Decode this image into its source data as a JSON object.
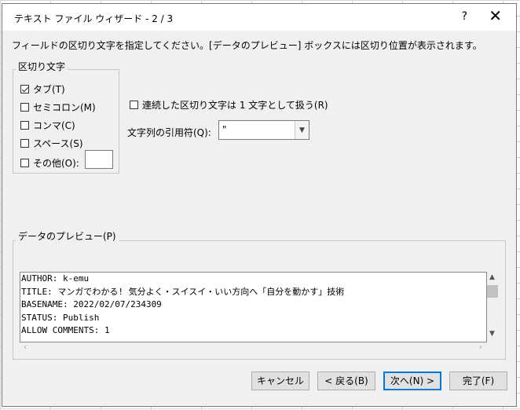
{
  "dialog": {
    "title": "テキスト ファイル ウィザード - 2 / 3",
    "help_label": "?",
    "close_label": "✕",
    "instruction": "フィールドの区切り文字を指定してください。[データのプレビュー] ボックスには区切り位置が表示されます。"
  },
  "delimiters": {
    "group_label": "区切り文字",
    "items": [
      {
        "label": "タブ(T)",
        "checked": true
      },
      {
        "label": "セミコロン(M)",
        "checked": false
      },
      {
        "label": "コンマ(C)",
        "checked": false
      },
      {
        "label": "スペース(S)",
        "checked": false
      },
      {
        "label": "その他(O):",
        "checked": false
      }
    ],
    "other_value": ""
  },
  "options": {
    "consecutive_label": "連続した区切り文字は 1 文字として扱う(R)",
    "consecutive_checked": false,
    "text_qualifier_label": "文字列の引用符(Q):",
    "text_qualifier_value": "\""
  },
  "preview": {
    "label": "データのプレビュー(P)",
    "lines": [
      "AUTHOR: k-emu",
      "TITLE: マンガでわかる! 気分よく・スイスイ・いい方向へ「自分を動かす」技術",
      "BASENAME: 2022/02/07/234309",
      "STATUS: Publish",
      "ALLOW COMMENTS: 1"
    ]
  },
  "buttons": {
    "cancel": "キャンセル",
    "back": "< 戻る(B)",
    "next": "次へ(N) >",
    "finish": "完了(F)"
  },
  "colors": {
    "dialog_bg": "#f0f0f0",
    "default_button_border": "#0078d7"
  }
}
